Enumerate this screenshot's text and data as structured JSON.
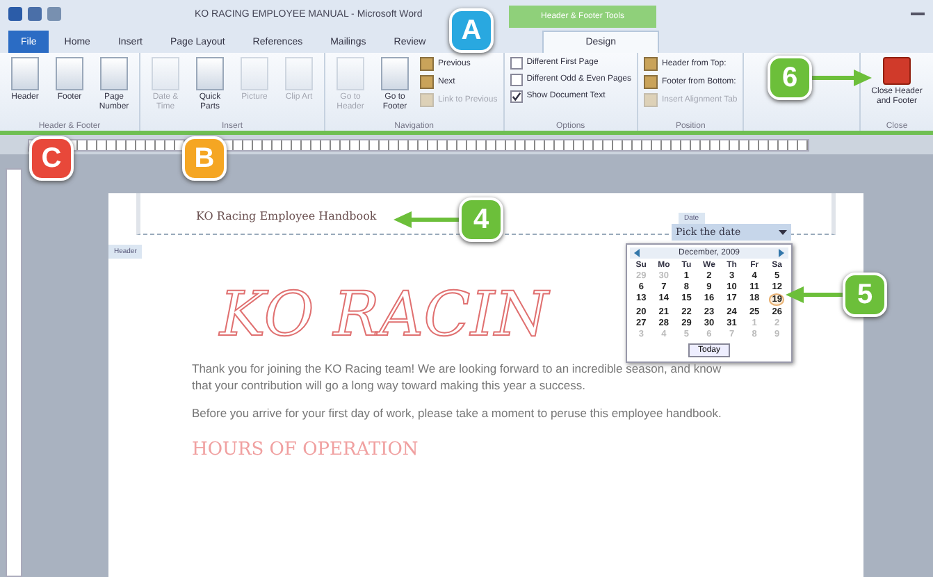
{
  "window": {
    "title": "KO RACING EMPLOYEE MANUAL - Microsoft Word",
    "contextual_tab": "Header & Footer Tools"
  },
  "tabs": [
    {
      "label": "File",
      "selected": false,
      "kind": "file"
    },
    {
      "label": "Home",
      "selected": false,
      "kind": "tab"
    },
    {
      "label": "Insert",
      "selected": false,
      "kind": "tab"
    },
    {
      "label": "Page Layout",
      "selected": false,
      "kind": "tab"
    },
    {
      "label": "References",
      "selected": false,
      "kind": "tab"
    },
    {
      "label": "Mailings",
      "selected": false,
      "kind": "tab"
    },
    {
      "label": "Review",
      "selected": false,
      "kind": "tab"
    },
    {
      "label": "Design",
      "selected": true,
      "kind": "tab"
    }
  ],
  "ribbon_groups": [
    {
      "label": "Header & Footer",
      "items": [
        {
          "label": "Header",
          "kind": "large",
          "disabled": false
        },
        {
          "label": "Footer",
          "kind": "large",
          "disabled": false
        },
        {
          "label": "Page Number",
          "kind": "large",
          "disabled": false
        }
      ]
    },
    {
      "label": "Insert",
      "items": [
        {
          "label": "Date & Time",
          "kind": "large",
          "disabled": true
        },
        {
          "label": "Quick Parts",
          "kind": "large",
          "disabled": false
        },
        {
          "label": "Picture",
          "kind": "large",
          "disabled": true
        },
        {
          "label": "Clip Art",
          "kind": "large",
          "disabled": true
        }
      ]
    },
    {
      "label": "Navigation",
      "items": [
        {
          "label": "Go to Header",
          "kind": "large",
          "disabled": true
        },
        {
          "label": "Go to Footer",
          "kind": "large",
          "disabled": false
        },
        {
          "label": "Previous",
          "kind": "small",
          "disabled": false
        },
        {
          "label": "Next",
          "kind": "small",
          "disabled": false
        },
        {
          "label": "Link to Previous",
          "kind": "small",
          "disabled": true
        }
      ]
    },
    {
      "label": "Options",
      "items": [
        {
          "label": "Different First Page",
          "kind": "check",
          "checked": false
        },
        {
          "label": "Different Odd & Even Pages",
          "kind": "check",
          "checked": false
        },
        {
          "label": "Show Document Text",
          "kind": "check",
          "checked": true
        }
      ]
    },
    {
      "label": "Position",
      "items": [
        {
          "label": "Header from Top:",
          "kind": "small",
          "disabled": false
        },
        {
          "label": "Footer from Bottom:",
          "kind": "small",
          "disabled": false
        },
        {
          "label": "Insert Alignment Tab",
          "kind": "small",
          "disabled": true
        }
      ]
    },
    {
      "label": "Close",
      "items": [
        {
          "label": "Close Header and Footer",
          "kind": "close",
          "disabled": false
        }
      ]
    }
  ],
  "document": {
    "header_text": "KO Racing Employee Handbook",
    "header_tag": "Header",
    "date_label": "Date",
    "date_placeholder": "Pick the date",
    "title": "KO RACIN",
    "paragraphs": [
      "Thank you for joining the KO Racing team! We are looking forward to an incredible season, and know that your contribution will go a long way toward making this year a success.",
      "Before you arrive for your first day of work, please take a moment to peruse this employee handbook."
    ],
    "heading": "HOURS OF OPERATION"
  },
  "calendar": {
    "month": "December, 2009",
    "weekdays": [
      "Su",
      "Mo",
      "Tu",
      "We",
      "Th",
      "Fr",
      "Sa"
    ],
    "days": [
      {
        "label": "29",
        "outside": true,
        "today": false
      },
      {
        "label": "30",
        "outside": true,
        "today": false
      },
      {
        "label": "1",
        "outside": false,
        "today": false
      },
      {
        "label": "2",
        "outside": false,
        "today": false
      },
      {
        "label": "3",
        "outside": false,
        "today": false
      },
      {
        "label": "4",
        "outside": false,
        "today": false
      },
      {
        "label": "5",
        "outside": false,
        "today": false
      },
      {
        "label": "6",
        "outside": false,
        "today": false
      },
      {
        "label": "7",
        "outside": false,
        "today": false
      },
      {
        "label": "8",
        "outside": false,
        "today": false
      },
      {
        "label": "9",
        "outside": false,
        "today": false
      },
      {
        "label": "10",
        "outside": false,
        "today": false
      },
      {
        "label": "11",
        "outside": false,
        "today": false
      },
      {
        "label": "12",
        "outside": false,
        "today": false
      },
      {
        "label": "13",
        "outside": false,
        "today": false
      },
      {
        "label": "14",
        "outside": false,
        "today": false
      },
      {
        "label": "15",
        "outside": false,
        "today": false
      },
      {
        "label": "16",
        "outside": false,
        "today": false
      },
      {
        "label": "17",
        "outside": false,
        "today": false
      },
      {
        "label": "18",
        "outside": false,
        "today": false
      },
      {
        "label": "19",
        "outside": false,
        "today": true
      },
      {
        "label": "20",
        "outside": false,
        "today": false
      },
      {
        "label": "21",
        "outside": false,
        "today": false
      },
      {
        "label": "22",
        "outside": false,
        "today": false
      },
      {
        "label": "23",
        "outside": false,
        "today": false
      },
      {
        "label": "24",
        "outside": false,
        "today": false
      },
      {
        "label": "25",
        "outside": false,
        "today": false
      },
      {
        "label": "26",
        "outside": false,
        "today": false
      },
      {
        "label": "27",
        "outside": false,
        "today": false
      },
      {
        "label": "28",
        "outside": false,
        "today": false
      },
      {
        "label": "29",
        "outside": false,
        "today": false
      },
      {
        "label": "30",
        "outside": false,
        "today": false
      },
      {
        "label": "31",
        "outside": false,
        "today": false
      },
      {
        "label": "1",
        "outside": true,
        "today": false
      },
      {
        "label": "2",
        "outside": true,
        "today": false
      },
      {
        "label": "3",
        "outside": true,
        "today": false
      },
      {
        "label": "4",
        "outside": true,
        "today": false
      },
      {
        "label": "5",
        "outside": true,
        "today": false
      },
      {
        "label": "6",
        "outside": true,
        "today": false
      },
      {
        "label": "7",
        "outside": true,
        "today": false
      },
      {
        "label": "8",
        "outside": true,
        "today": false
      },
      {
        "label": "9",
        "outside": true,
        "today": false
      }
    ],
    "today_button": "Today"
  },
  "callouts": [
    {
      "label": "A",
      "color": "#29a8e0",
      "kind": "plain"
    },
    {
      "label": "B",
      "color": "#f5a623",
      "kind": "plain"
    },
    {
      "label": "C",
      "color": "#e8483a",
      "kind": "plain"
    },
    {
      "label": "4",
      "color": "#6cbf3a",
      "kind": "pointing-left"
    },
    {
      "label": "5",
      "color": "#6cbf3a",
      "kind": "pointing-left"
    },
    {
      "label": "6",
      "color": "#6cbf3a",
      "kind": "pointing-right"
    }
  ]
}
